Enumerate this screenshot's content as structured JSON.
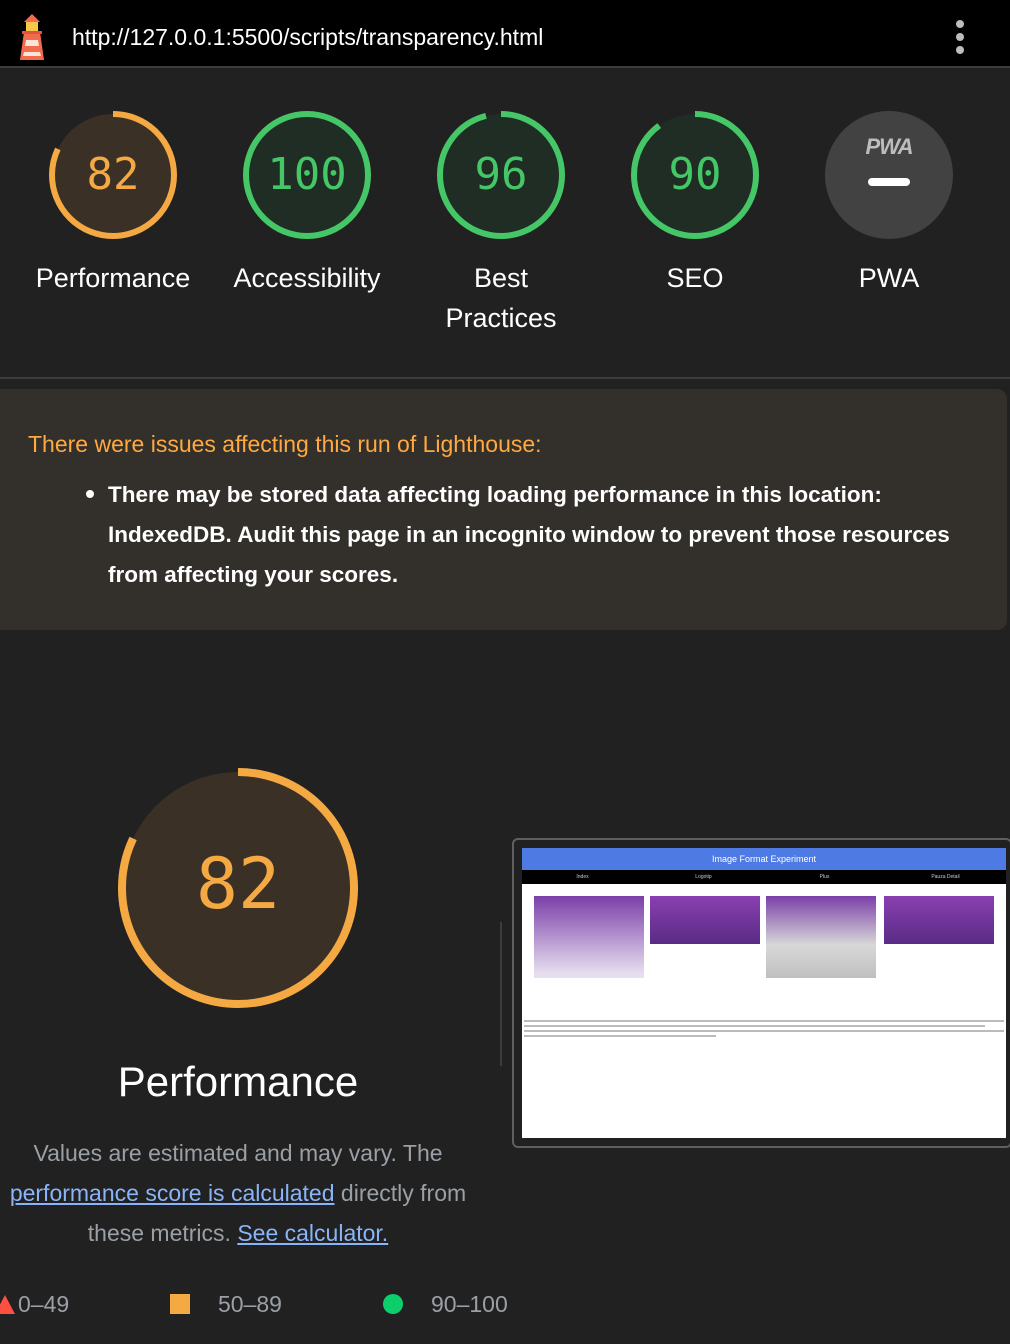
{
  "browser": {
    "url": "http://127.0.0.1:5500/scripts/transparency.html",
    "logo_icon": "lighthouse-icon",
    "menu_icon": "kebab-menu-icon"
  },
  "scores": [
    {
      "value": "82",
      "label": "Performance",
      "fraction": 0.82,
      "color": "#f4a942",
      "bg": "#3a3026"
    },
    {
      "value": "100",
      "label": "Accessibility",
      "fraction": 1.0,
      "color": "#45c767",
      "bg": "#1f2d24"
    },
    {
      "value": "96",
      "label": "Best Practices",
      "fraction": 0.96,
      "color": "#45c767",
      "bg": "#1f2d24"
    },
    {
      "value": "90",
      "label": "SEO",
      "fraction": 0.9,
      "color": "#45c767",
      "bg": "#1f2d24"
    }
  ],
  "pwa": {
    "badge": "PWA",
    "label": "PWA",
    "value_icon": "dash-icon"
  },
  "warning": {
    "title": "There were issues affecting this run of Lighthouse:",
    "items": [
      "There may be stored data affecting loading performance in this location: IndexedDB. Audit this page in an incognito window to prevent those resources from affecting your scores."
    ]
  },
  "performance": {
    "score": "82",
    "fraction": 0.82,
    "title": "Performance",
    "desc_prefix": "Values are estimated and may vary. The ",
    "desc_link1": "performance score is calculated",
    "desc_middle": " directly from these metrics. ",
    "desc_link2": "See calculator."
  },
  "thumbnail": {
    "header": "Image Format Experiment",
    "nav": [
      "Index",
      "Logotip",
      "Plus",
      "Pauza Detail"
    ]
  },
  "legend": {
    "fail": "0–49",
    "average": "50–89",
    "pass": "90–100"
  },
  "colors": {
    "average": "#f4a942",
    "pass": "#45c767",
    "fail": "#ff4e42"
  }
}
